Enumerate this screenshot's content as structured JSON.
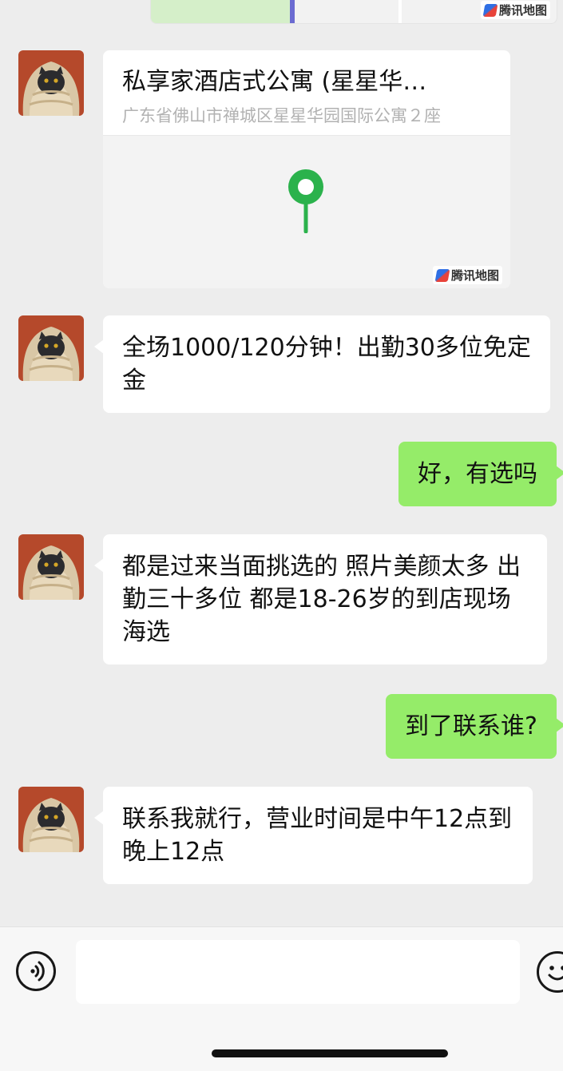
{
  "top_map": {
    "logo_text": "腾讯地图"
  },
  "location_card": {
    "title": "私享家酒店式公寓 (星星华…",
    "address": "广东省佛山市禅城区星星华园国际公寓２座",
    "logo_text": "腾讯地图"
  },
  "messages": [
    {
      "sender": "other",
      "text": "全场1000/120分钟！出勤30多位免定金"
    },
    {
      "sender": "me",
      "text": "好，有选吗"
    },
    {
      "sender": "other",
      "text": "都是过来当面挑选的 照片美颜太多 出勤三十多位 都是18-26岁的到店现场海选"
    },
    {
      "sender": "me",
      "text": "到了联系谁?"
    },
    {
      "sender": "other",
      "text": "联系我就行，营业时间是中午12点到晚上12点"
    }
  ],
  "input": {
    "value": ""
  },
  "colors": {
    "background": "#ededed",
    "incoming_bubble": "#ffffff",
    "outgoing_bubble": "#95ec69",
    "pin": "#2bb24c"
  }
}
